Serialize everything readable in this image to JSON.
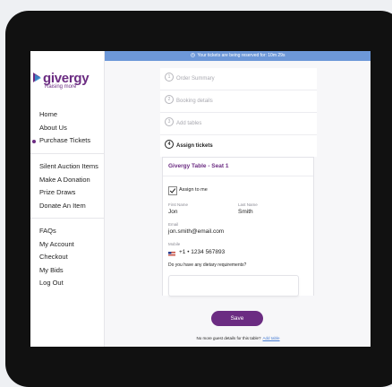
{
  "banner": {
    "text": "Your tickets are being reserved for: 10m 29s"
  },
  "brand": {
    "name": "givergy",
    "tagline": "Raising more",
    "color": "#6b2c82"
  },
  "sidebar": {
    "groups": [
      [
        {
          "label": "Home",
          "active": false
        },
        {
          "label": "About Us",
          "active": false
        },
        {
          "label": "Purchase Tickets",
          "active": true
        }
      ],
      [
        {
          "label": "Silent Auction Items",
          "active": false
        },
        {
          "label": "Make A Donation",
          "active": false
        },
        {
          "label": "Prize Draws",
          "active": false
        },
        {
          "label": "Donate An Item",
          "active": false
        }
      ],
      [
        {
          "label": "FAQs",
          "active": false
        },
        {
          "label": "My Account",
          "active": false
        },
        {
          "label": "Checkout",
          "active": false
        },
        {
          "label": "My Bids",
          "active": false
        },
        {
          "label": "Log Out",
          "active": false
        }
      ]
    ]
  },
  "steps": [
    {
      "num": "1",
      "label": "Order Summary",
      "current": false
    },
    {
      "num": "2",
      "label": "Booking details",
      "current": false
    },
    {
      "num": "3",
      "label": "Add tables",
      "current": false
    },
    {
      "num": "4",
      "label": "Assign tickets",
      "current": true
    }
  ],
  "seat_card": {
    "title": "Givergy Table - Seat 1",
    "assign_label": "Assign to me",
    "assign_checked": true,
    "first_name_label": "First Name",
    "first_name": "Jon",
    "last_name_label": "Last Name",
    "last_name": "Smith",
    "email_label": "Email",
    "email": "jon.smith@email.com",
    "mobile_label": "Mobile",
    "mobile": "+1  •  1234 567893",
    "dietary_question": "Do you have any dietary requirements?",
    "dietary_value": ""
  },
  "actions": {
    "save_label": "Save",
    "footer_text": "No more guest details for this table?",
    "footer_link": "Add table"
  }
}
